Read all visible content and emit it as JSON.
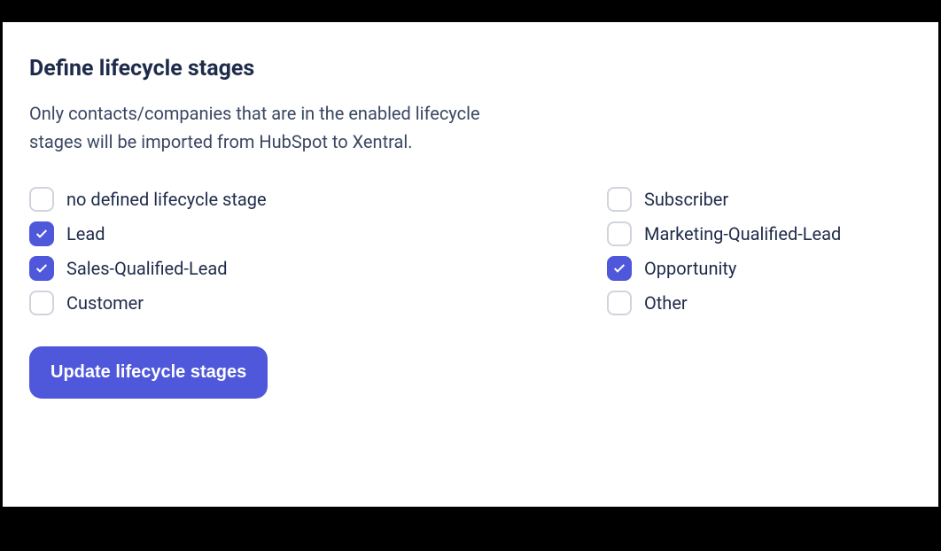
{
  "title": "Define lifecycle stages",
  "description": "Only contacts/companies that are in the enabled lifecycle stages will be imported from HubSpot to Xentral.",
  "options": {
    "left": [
      {
        "label": "no defined lifecycle stage",
        "checked": false
      },
      {
        "label": "Lead",
        "checked": true
      },
      {
        "label": "Sales-Qualified-Lead",
        "checked": true
      },
      {
        "label": "Customer",
        "checked": false
      }
    ],
    "right": [
      {
        "label": "Subscriber",
        "checked": false
      },
      {
        "label": "Marketing-Qualified-Lead",
        "checked": false
      },
      {
        "label": "Opportunity",
        "checked": true
      },
      {
        "label": "Other",
        "checked": false
      }
    ]
  },
  "button": "Update lifecycle stages"
}
